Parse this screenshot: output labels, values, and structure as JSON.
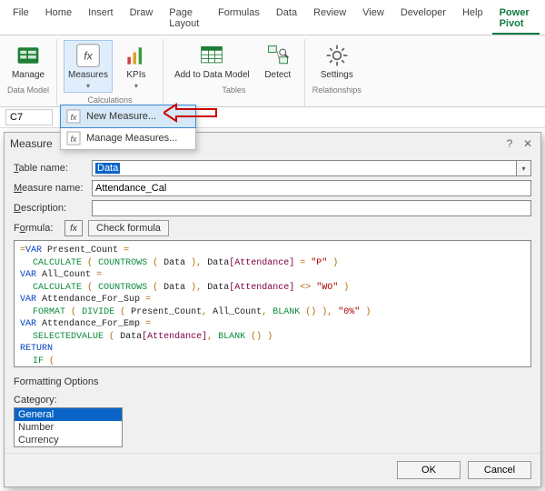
{
  "ribbon_tabs": [
    "File",
    "Home",
    "Insert",
    "Draw",
    "Page Layout",
    "Formulas",
    "Data",
    "Review",
    "View",
    "Developer",
    "Help",
    "Power Pivot"
  ],
  "ribbon_active_tab": "Power Pivot",
  "groups": {
    "data_model": {
      "title": "Data Model",
      "manage": "Manage"
    },
    "calculations": {
      "title": "Calculations",
      "measures": "Measures",
      "kpis": "KPIs"
    },
    "tables": {
      "title": "Tables",
      "add": "Add to\nData Model",
      "detect": "Detect"
    },
    "relationships": {
      "title": "Relationships",
      "settings": "Settings"
    }
  },
  "menu": {
    "new_measure": "New Measure...",
    "manage_measures": "Manage Measures..."
  },
  "namebox": "C7",
  "dialog": {
    "title": "Measure",
    "labels": {
      "table": "Table name:",
      "measure": "Measure name:",
      "description": "Description:",
      "formula": "Formula:",
      "check": "Check formula",
      "formatting": "Formatting Options",
      "category": "Category:",
      "ok": "OK",
      "cancel": "Cancel"
    },
    "values": {
      "table": "Data",
      "measure": "Attendance_Cal",
      "description": ""
    },
    "categories": [
      "General",
      "Number",
      "Currency"
    ],
    "category_selected": "General",
    "formula_text": "=VAR Present_Count =\n    CALCULATE ( COUNTROWS ( Data ), Data[Attendance] = \"P\" )\nVAR All_Count =\n    CALCULATE ( COUNTROWS ( Data ), Data[Attendance] <> \"WO\" )\nVAR Attendance_For_Sup =\n    FORMAT ( DIVIDE ( Present_Count, All_Count, BLANK () ), \"0%\" )\nVAR Attendance_For_Emp =\n    SELECTEDVALUE ( Data[Attendance], BLANK () )\nRETURN\n    IF (\n        ISINSCOPE ( Data[EMP Name] ),\n        Attendance_For_Emp,\n        IF ( ISINSCOPE ( Data[Supervisor] ), Attendance_For_Sup, BLANK () )\n    )"
  }
}
